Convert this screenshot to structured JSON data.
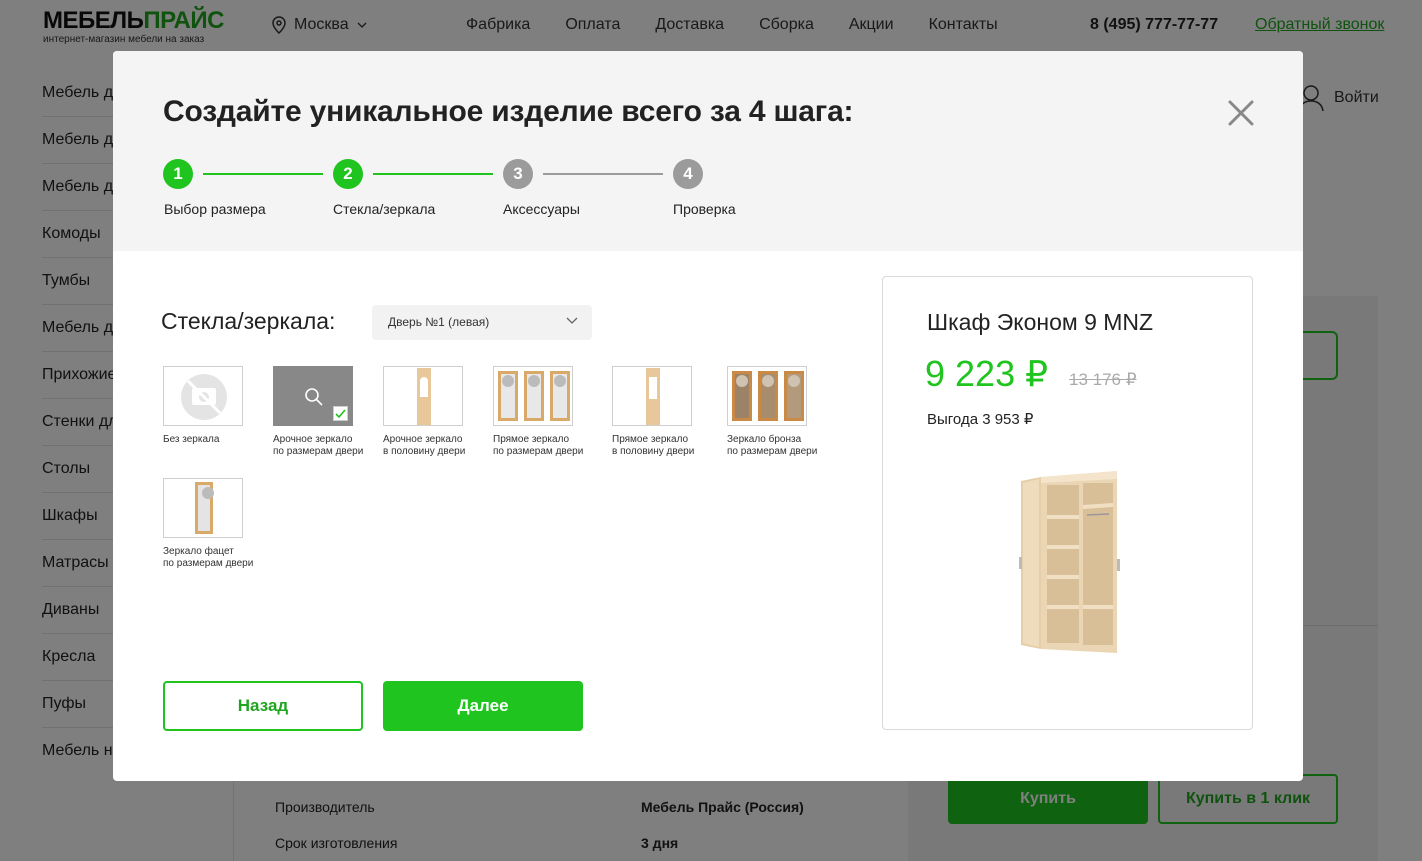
{
  "header": {
    "logo_main_black": "МЕБЕЛЬ",
    "logo_main_green": "ПРАЙС",
    "logo_sub": "интернет-магазин мебели на заказ",
    "city": "Москва",
    "nav": [
      "Фабрика",
      "Оплата",
      "Доставка",
      "Сборка",
      "Акции",
      "Контакты"
    ],
    "phone": "8 (495) 777-77-77",
    "callback": "Обратный звонок",
    "login": "Войти"
  },
  "sidebar": {
    "items": [
      "Мебель для",
      "Мебель для",
      "Мебель для",
      "Комоды",
      "Тумбы",
      "Мебель для",
      "Прихожие",
      "Стенки для",
      "Столы",
      "Шкафы",
      "Матрасы",
      "Диваны",
      "Кресла",
      "Пуфы",
      "Мебель на"
    ]
  },
  "background": {
    "buy": "Купить",
    "buy_one_click": "Купить в 1 клик",
    "specs": [
      {
        "label": "Производитель",
        "value": "Мебель Прайс (Россия)"
      },
      {
        "label": "Срок изготовления",
        "value": "3 дня"
      }
    ]
  },
  "modal": {
    "title": "Создайте уникальное изделие всего за 4 шага:",
    "steps": [
      {
        "num": "1",
        "label": "Выбор размера",
        "state": "active"
      },
      {
        "num": "2",
        "label": "Стекла/зеркала",
        "state": "active"
      },
      {
        "num": "3",
        "label": "Аксессуары",
        "state": "inactive"
      },
      {
        "num": "4",
        "label": "Проверка",
        "state": "inactive"
      }
    ],
    "section_title": "Стекла/зеркала:",
    "door_select": "Дверь №1 (левая)",
    "options": [
      {
        "label": "Без зеркала",
        "selected": false
      },
      {
        "label": "Арочное зеркало\nпо размерам двери",
        "selected": true
      },
      {
        "label": "Арочное зеркало\nв половину двери",
        "selected": false
      },
      {
        "label": "Прямое зеркало\nпо размерам двери",
        "selected": false
      },
      {
        "label": "Прямое зеркало\nв половину двери",
        "selected": false
      },
      {
        "label": "Зеркало бронза\nпо размерам двери",
        "selected": false
      },
      {
        "label": "Зеркало фацет\nпо размерам двери",
        "selected": false
      }
    ],
    "back": "Назад",
    "next": "Далее",
    "product": {
      "name": "Шкаф Эконом 9 MNZ",
      "price": "9 223 ₽",
      "old_price": "13 176 ₽",
      "saving": "Выгода 3 953 ₽"
    }
  },
  "colors": {
    "accent": "#1fc41f",
    "inactive": "#9b9b9b"
  }
}
